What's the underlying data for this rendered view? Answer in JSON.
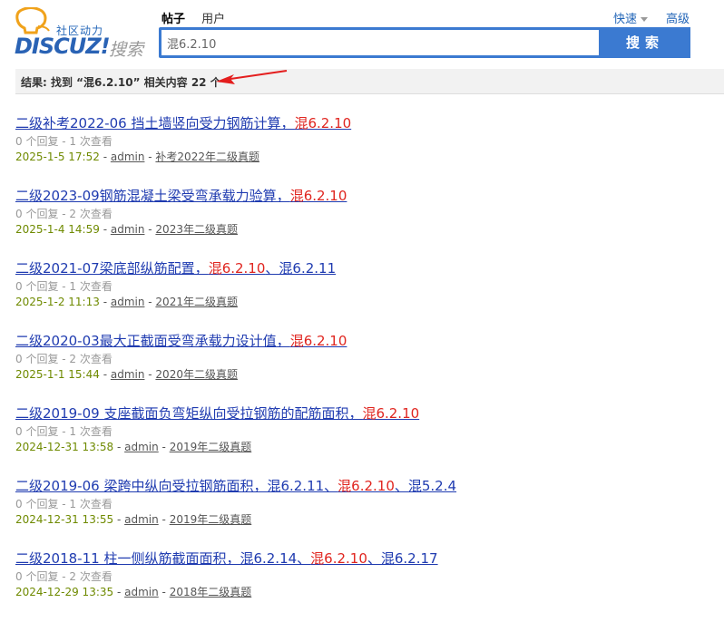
{
  "logo": {
    "slogan": "社区动力",
    "brand": "DISCUZ!",
    "brand_sub": "搜索"
  },
  "search": {
    "tabs": [
      "帖子",
      "用户"
    ],
    "quick_label": "快速",
    "advanced_label": "高级",
    "query": "混6.2.10",
    "button_label": "搜索"
  },
  "result_summary": {
    "prefix": "结果: 找到 “",
    "keyword": "混6.2.10",
    "suffix": "” 相关内容 22 个"
  },
  "results": [
    {
      "title_parts": [
        {
          "t": "二级补考2022-06 挡土墙竖向受力钢筋计算，"
        },
        {
          "t": "混6.2.10",
          "hl": true
        }
      ],
      "stats": "0 个回复 - 1 次查看",
      "date": "2025-1-5 17:52",
      "author": "admin",
      "forum": "补考2022年二级真题"
    },
    {
      "title_parts": [
        {
          "t": "二级2023-09钢筋混凝土梁受弯承载力验算，"
        },
        {
          "t": "混6.2.10",
          "hl": true
        }
      ],
      "stats": "0 个回复 - 2 次查看",
      "date": "2025-1-4 14:59",
      "author": "admin",
      "forum": "2023年二级真题"
    },
    {
      "title_parts": [
        {
          "t": "二级2021-07梁底部纵筋配置，"
        },
        {
          "t": "混6.2.10",
          "hl": true
        },
        {
          "t": "、混6.2.11"
        }
      ],
      "stats": "0 个回复 - 1 次查看",
      "date": "2025-1-2 11:13",
      "author": "admin",
      "forum": "2021年二级真题"
    },
    {
      "title_parts": [
        {
          "t": "二级2020-03最大正截面受弯承载力设计值，"
        },
        {
          "t": "混6.2.10",
          "hl": true
        }
      ],
      "stats": "0 个回复 - 2 次查看",
      "date": "2025-1-1 15:44",
      "author": "admin",
      "forum": "2020年二级真题"
    },
    {
      "title_parts": [
        {
          "t": "二级2019-09 支座截面负弯矩纵向受拉钢筋的配筋面积，"
        },
        {
          "t": "混6.2.10",
          "hl": true
        }
      ],
      "stats": "0 个回复 - 1 次查看",
      "date": "2024-12-31 13:58",
      "author": "admin",
      "forum": "2019年二级真题"
    },
    {
      "title_parts": [
        {
          "t": "二级2019-06 梁跨中纵向受拉钢筋面积，混6.2.11、"
        },
        {
          "t": "混6.2.10",
          "hl": true
        },
        {
          "t": "、混5.2.4"
        }
      ],
      "stats": "0 个回复 - 1 次查看",
      "date": "2024-12-31 13:55",
      "author": "admin",
      "forum": "2019年二级真题"
    },
    {
      "title_parts": [
        {
          "t": "二级2018-11 柱一侧纵筋截面面积，混6.2.14、"
        },
        {
          "t": "混6.2.10",
          "hl": true
        },
        {
          "t": "、混6.2.17"
        }
      ],
      "stats": "0 个回复 - 2 次查看",
      "date": "2024-12-29 13:35",
      "author": "admin",
      "forum": "2018年二级真题"
    }
  ],
  "colors": {
    "accent": "#3b7ad1",
    "link": "#1f3bb0",
    "highlight": "#e0251f",
    "date": "#6f8a00",
    "arrow": "#e41e1e"
  },
  "icons": {
    "logo": "lightbulb-icon",
    "arrow": "red-arrow-icon"
  }
}
